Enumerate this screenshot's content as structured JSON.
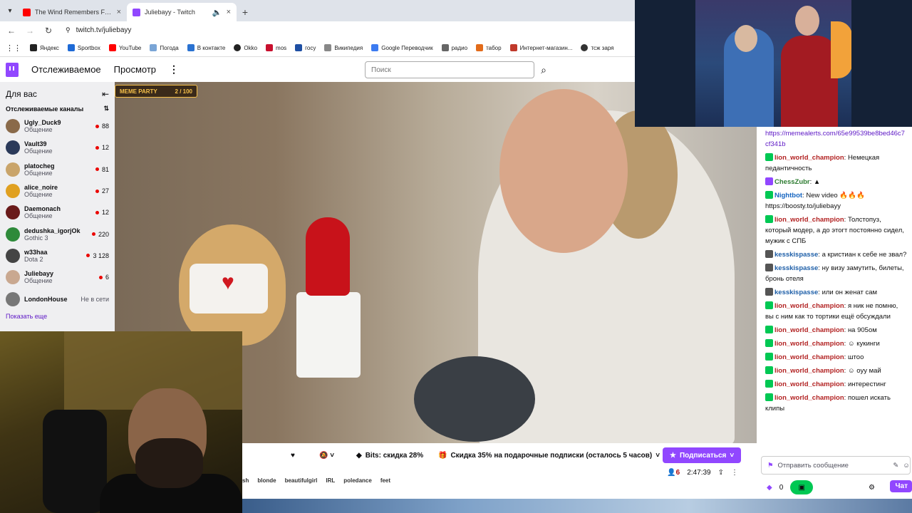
{
  "browser": {
    "tabs": [
      {
        "title": "The Wind Remembers Folktron",
        "fav_color": "#ff0000"
      },
      {
        "title": "Juliebayy - Twitch",
        "fav_color": "#9147ff"
      }
    ],
    "new_tab": "+",
    "url": "twitch.tv/juliebayy",
    "bookmarks": [
      {
        "label": "Яндекс",
        "color": "#222"
      },
      {
        "label": "Sportbox",
        "color": "#1e6ad6"
      },
      {
        "label": "YouTube",
        "color": "#ff0000"
      },
      {
        "label": "Погода",
        "color": "#7aa5d6"
      },
      {
        "label": "В контакте",
        "color": "#2a72d1"
      },
      {
        "label": "Okko",
        "color": "#222"
      },
      {
        "label": "mos",
        "color": "#c8102e"
      },
      {
        "label": "госу",
        "color": "#1e4fa3"
      },
      {
        "label": "Википедия",
        "color": "#888"
      },
      {
        "label": "Google Переводчик",
        "color": "#3c7bf1"
      },
      {
        "label": "радио",
        "color": "#666"
      },
      {
        "label": "табор",
        "color": "#e26b1a"
      },
      {
        "label": "Интернет-магазин...",
        "color": "#c0392b"
      },
      {
        "label": "тсж заря",
        "color": "#333"
      }
    ]
  },
  "twitch": {
    "nav": {
      "following": "Отслеживаемое",
      "browse": "Просмотр",
      "more": "⋮"
    },
    "search_placeholder": "Поиск",
    "sidebar": {
      "title": "Для вас",
      "section": "Отслеживаемые каналы",
      "channels": [
        {
          "name": "Ugly_Duck9",
          "category": "Общение",
          "viewers": "88",
          "color": "#8a6a4a"
        },
        {
          "name": "Vault39",
          "category": "Общение",
          "viewers": "12",
          "color": "#2b3a5a"
        },
        {
          "name": "platocheg",
          "category": "Общение",
          "viewers": "81",
          "color": "#c9a46a"
        },
        {
          "name": "alice_noire",
          "category": "Общение",
          "viewers": "27",
          "color": "#e0a020"
        },
        {
          "name": "Daemonach",
          "category": "Общение",
          "viewers": "12",
          "color": "#6a1a1a"
        },
        {
          "name": "dedushka_igorjOk",
          "category": "Gothic 3",
          "viewers": "220",
          "color": "#2e8a3a"
        },
        {
          "name": "w33haa",
          "category": "Dota 2",
          "viewers": "3 128",
          "color": "#444"
        },
        {
          "name": "Juliebayy",
          "category": "Общение",
          "viewers": "6",
          "color": "#c9a890"
        },
        {
          "name": "LondonHouse",
          "category": "",
          "viewers": "Не в сети",
          "color": "#777"
        }
      ],
      "show_more": "Показать еще"
    },
    "overlay": {
      "meme_label": "MEME PARTY",
      "meme_count": "2 / 100"
    },
    "actions": {
      "bits": "Bits: скидка 28%",
      "gift": "Скидка 35% на подарочные подписки (осталось 5 часов)",
      "subscribe": "Подписаться"
    },
    "tags": [
      "sh",
      "blonde",
      "beautifulgirl",
      "IRL",
      "poledance",
      "feet"
    ],
    "meta": {
      "viewers": "6",
      "uptime": "2:47:39"
    },
    "chat": {
      "messages": [
        {
          "user": "",
          "text": "https://memealerts.com/65e99539be8bed46c7cf341b",
          "link": true,
          "badge": ""
        },
        {
          "user": "lion_world_champion",
          "text": "Немецкая педантичность",
          "badge": "#00c853",
          "color": "#b22222"
        },
        {
          "user": "ChessZubr",
          "text": "",
          "badge": "#9147ff",
          "color": "#2e7d32"
        },
        {
          "user": "Nightbot",
          "text": "New video 🔥🔥🔥 https://boosty.to/juliebayy",
          "badge": "#00c853",
          "color": "#1565c0"
        },
        {
          "user": "lion_world_champion",
          "text": "Толстопуз, который модер, а до этогт постоянно сидел, мужик с СПБ",
          "badge": "#00c853",
          "color": "#b22222"
        },
        {
          "user": "kesskispasse",
          "text": "а кристиан к себе не звал?",
          "badge": "#555",
          "color": "#1e5fa8"
        },
        {
          "user": "kesskispasse",
          "text": "ну визу замутить, билеты, бронь отеля",
          "badge": "#555",
          "color": "#1e5fa8"
        },
        {
          "user": "kesskispasse",
          "text": "или он женат сам",
          "badge": "#555",
          "color": "#1e5fa8"
        },
        {
          "user": "lion_world_champion",
          "text": "я ник не помню, вы с ним как то тортики ещё обсуждали",
          "badge": "#00c853",
          "color": "#b22222"
        },
        {
          "user": "lion_world_champion",
          "text": "на 905ом",
          "badge": "#00c853",
          "color": "#b22222"
        },
        {
          "user": "lion_world_champion",
          "text": "кукинги",
          "badge": "#00c853",
          "color": "#b22222"
        },
        {
          "user": "lion_world_champion",
          "text": "штоо",
          "badge": "#00c853",
          "color": "#b22222"
        },
        {
          "user": "lion_world_champion",
          "text": "оуу май",
          "badge": "#00c853",
          "color": "#b22222"
        },
        {
          "user": "lion_world_champion",
          "text": "интерестинг",
          "badge": "#00c853",
          "color": "#b22222"
        },
        {
          "user": "lion_world_champion",
          "text": "пошел искать клипы",
          "badge": "#00c853",
          "color": "#b22222"
        }
      ],
      "input_placeholder": "Отправить сообщение",
      "points": "0",
      "chat_button": "Чат"
    }
  },
  "colors": {
    "accent": "#9147ff",
    "live": "#eb0400"
  }
}
